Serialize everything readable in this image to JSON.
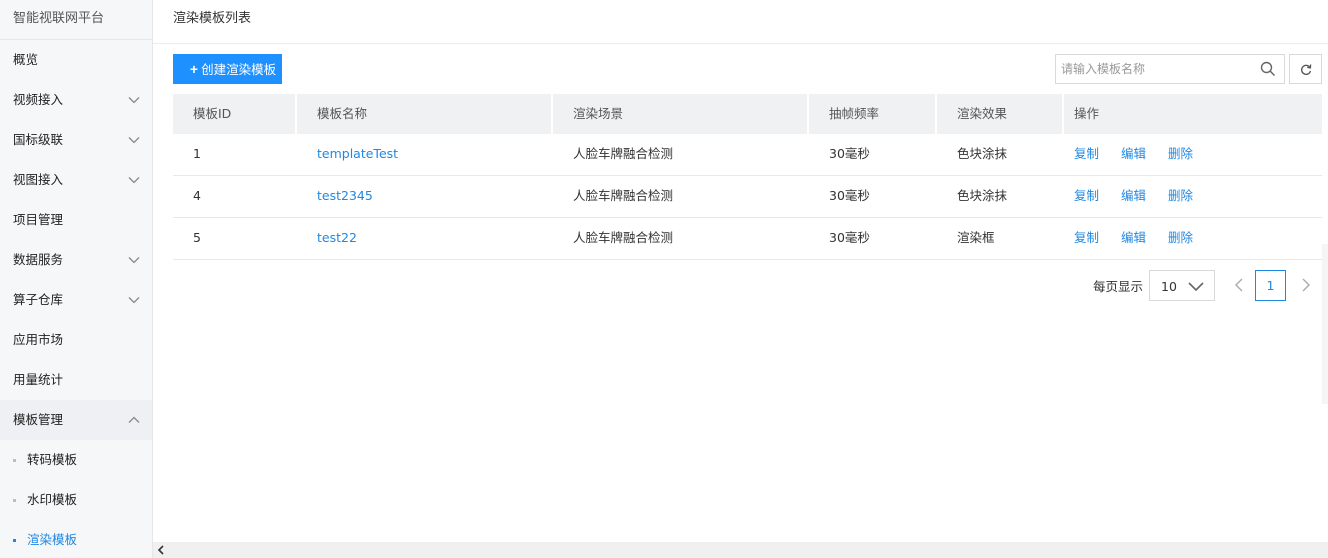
{
  "sidebar": {
    "brand": "智能视联网平台",
    "items": [
      {
        "label": "概览",
        "has_chevron": false
      },
      {
        "label": "视频接入",
        "has_chevron": true
      },
      {
        "label": "国标级联",
        "has_chevron": true
      },
      {
        "label": "视图接入",
        "has_chevron": true
      },
      {
        "label": "项目管理",
        "has_chevron": false
      },
      {
        "label": "数据服务",
        "has_chevron": true
      },
      {
        "label": "算子仓库",
        "has_chevron": true
      },
      {
        "label": "应用市场",
        "has_chevron": false
      },
      {
        "label": "用量统计",
        "has_chevron": false
      },
      {
        "label": "模板管理",
        "has_chevron": true,
        "expanded": true
      }
    ],
    "sub_items": [
      {
        "label": "转码模板"
      },
      {
        "label": "水印模板"
      },
      {
        "label": "渲染模板",
        "active": true
      }
    ]
  },
  "page": {
    "title": "渲染模板列表",
    "create_button": "创建渲染模板",
    "search_placeholder": "请输入模板名称"
  },
  "table": {
    "headers": [
      "模板ID",
      "模板名称",
      "渲染场景",
      "抽帧频率",
      "渲染效果",
      "操作"
    ],
    "rows": [
      {
        "id": "1",
        "name": "templateTest",
        "scene": "人脸车牌融合检测",
        "freq": "30毫秒",
        "effect": "色块涂抹"
      },
      {
        "id": "4",
        "name": "test2345",
        "scene": "人脸车牌融合检测",
        "freq": "30毫秒",
        "effect": "色块涂抹"
      },
      {
        "id": "5",
        "name": "test22",
        "scene": "人脸车牌融合检测",
        "freq": "30毫秒",
        "effect": "渲染框"
      }
    ],
    "actions": [
      "复制",
      "编辑",
      "删除"
    ]
  },
  "pagination": {
    "per_page_label": "每页显示",
    "page_size": "10",
    "current_page": "1"
  },
  "colors": {
    "accent": "#1e88e5",
    "button": "#1e90ff"
  }
}
